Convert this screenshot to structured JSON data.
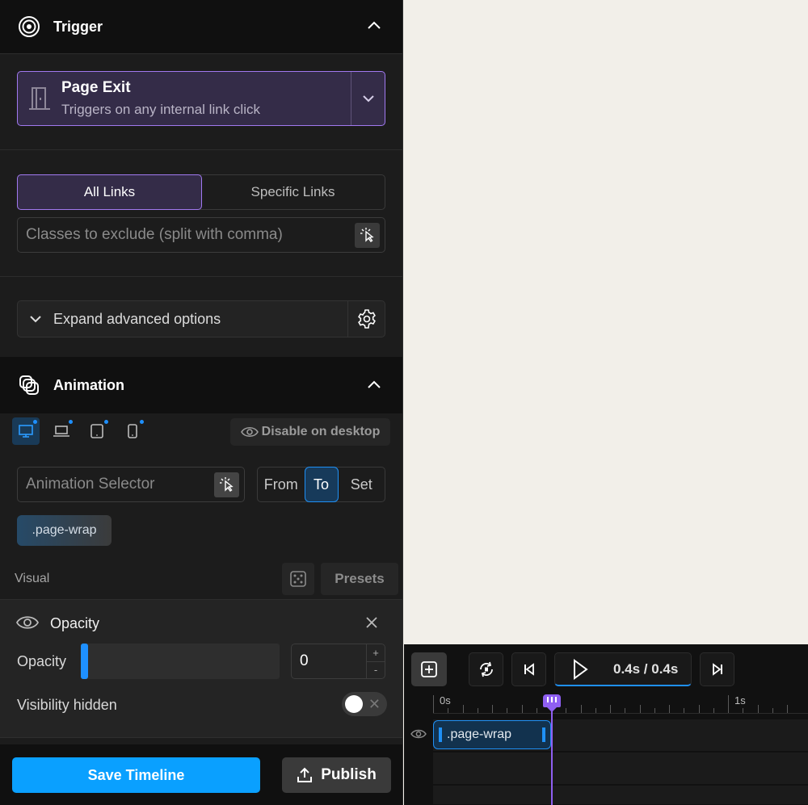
{
  "trigger": {
    "section_title": "Trigger",
    "selected_title": "Page Exit",
    "selected_subtitle": "Triggers on any internal link click",
    "link_modes": [
      "All Links",
      "Specific Links"
    ],
    "active_link_mode": "All Links",
    "exclude_placeholder": "Classes to exclude (split with comma)",
    "advanced_label": "Expand advanced options"
  },
  "animation": {
    "section_title": "Animation",
    "disable_label": "Disable on desktop",
    "selector_placeholder": "Animation Selector",
    "modes": [
      "From",
      "To",
      "Set"
    ],
    "active_mode": "To",
    "selector_chip": ".page-wrap",
    "visual_label": "Visual",
    "presets_label": "Presets",
    "opacity": {
      "card_title": "Opacity",
      "slider_label": "Opacity",
      "value": "0",
      "stepper_up": "+",
      "stepper_down": "-",
      "visibility_label": "Visibility hidden",
      "toggle_x": "✕"
    }
  },
  "footer": {
    "save_label": "Save Timeline",
    "publish_label": "Publish"
  },
  "timeline": {
    "time_display": "0.4s / 0.4s",
    "ruler_labels": [
      "0s",
      "1s"
    ],
    "clip_label": ".page-wrap",
    "playhead_time": 0.4
  },
  "colors": {
    "accent_purple": "#a179f0",
    "accent_blue": "#1f90f5",
    "save_blue": "#0aa0ff",
    "panel_bg": "#1c1c1c",
    "canvas_bg": "#f2efe9"
  }
}
